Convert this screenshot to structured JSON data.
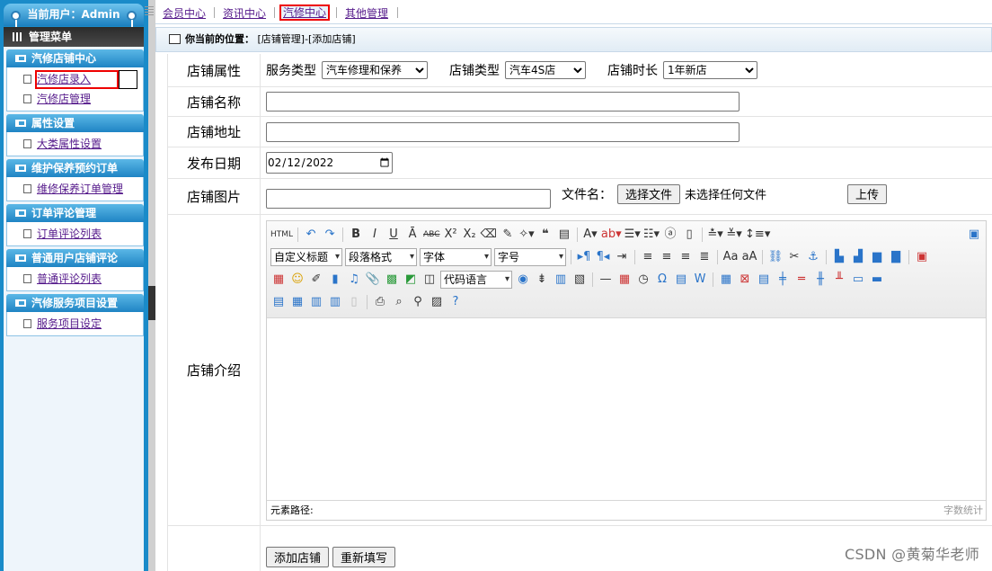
{
  "sidebar": {
    "user_label": "当前用户：Admin",
    "menu_title": "管理菜单",
    "groups": [
      {
        "title": "汽修店铺中心",
        "items": [
          {
            "label": "汽修店录入"
          },
          {
            "label": "汽修店管理"
          }
        ]
      },
      {
        "title": "属性设置",
        "items": [
          {
            "label": "大类属性设置"
          }
        ]
      },
      {
        "title": "维护保养预约订单",
        "items": [
          {
            "label": "维修保养订单管理"
          }
        ]
      },
      {
        "title": "订单评论管理",
        "items": [
          {
            "label": "订单评论列表"
          }
        ]
      },
      {
        "title": "普通用户店铺评论",
        "items": [
          {
            "label": "普通评论列表"
          }
        ]
      },
      {
        "title": "汽修服务项目设置",
        "items": [
          {
            "label": "服务项目设定"
          }
        ]
      }
    ]
  },
  "topnav": {
    "tabs": [
      {
        "label": "会员中心",
        "active": false
      },
      {
        "label": "资讯中心",
        "active": false
      },
      {
        "label": "汽修中心",
        "active": true
      },
      {
        "label": "其他管理",
        "active": false
      }
    ]
  },
  "breadcrumb": {
    "prefix": "你当前的位置：",
    "path": "[店铺管理]-[添加店铺]"
  },
  "form": {
    "attr_label": "店铺属性",
    "service_type_label": "服务类型",
    "service_type_value": "汽车修理和保养",
    "shop_type_label": "店铺类型",
    "shop_type_value": "汽车4S店",
    "shop_age_label": "店铺时长",
    "shop_age_value": "1年新店",
    "name_label": "店铺名称",
    "name_value": "",
    "address_label": "店铺地址",
    "address_value": "",
    "date_label": "发布日期",
    "date_value": "2022-02-12",
    "image_label": "店铺图片",
    "image_value": "",
    "file_name_label": "文件名：",
    "choose_file_label": "选择文件",
    "no_file_text": "未选择任何文件",
    "upload_label": "上传",
    "intro_label": "店铺介绍",
    "submit_label": "添加店铺",
    "reset_label": "重新填写"
  },
  "editor": {
    "heading_combo": "自定义标题",
    "paragraph_combo": "段落格式",
    "font_combo": "字体",
    "size_combo": "字号",
    "code_combo": "代码语言",
    "path_label": "元素路径:",
    "word_count_label": "字数统计"
  },
  "watermark": "CSDN @黄菊华老师"
}
